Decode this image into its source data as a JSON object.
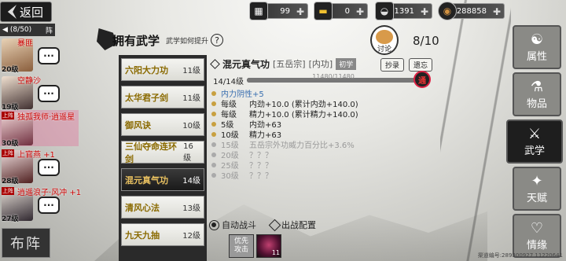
{
  "topbar": {
    "back_label": "返回",
    "resources": [
      {
        "icon": "ticket-icon",
        "value": "99"
      },
      {
        "icon": "gold-bar-icon",
        "value": "0"
      },
      {
        "icon": "silver-ingot-icon",
        "value": "1391"
      },
      {
        "icon": "copper-coin-icon",
        "value": "288858"
      }
    ]
  },
  "team": {
    "header": "(8/50)",
    "header_badge": "阵",
    "members": [
      {
        "name": "暴匪",
        "level": "20级",
        "tag": ""
      },
      {
        "name": "空静沙",
        "level": "19级",
        "tag": ""
      },
      {
        "name": "独孤我师·逍遥星",
        "level": "30级",
        "tag": "上阵"
      },
      {
        "name": "上官燕 +1",
        "level": "28级",
        "tag": "上阵"
      },
      {
        "name": "逍遥浪子·风冲 +1",
        "level": "27级",
        "tag": "上阵"
      }
    ],
    "formation_label": "布阵"
  },
  "nav": [
    {
      "label": "属性",
      "icon": "attribute-icon",
      "active": false
    },
    {
      "label": "物品",
      "icon": "item-icon",
      "active": false
    },
    {
      "label": "武学",
      "icon": "martial-arts-icon",
      "active": true
    },
    {
      "label": "天赋",
      "icon": "talent-icon",
      "active": false
    },
    {
      "label": "情缘",
      "icon": "affinity-icon",
      "active": false
    }
  ],
  "panel": {
    "title": "拥有武学",
    "hint": "武学如何提升",
    "help": "?",
    "discuss_label": "讨论",
    "count": "8/10"
  },
  "skills": [
    {
      "name": "六阳大力功",
      "level": "11级"
    },
    {
      "name": "太华君子剑",
      "level": "11级"
    },
    {
      "name": "御风诀",
      "level": "10级"
    },
    {
      "name": "三仙夺命连环剑",
      "level": "16级"
    },
    {
      "name": "混元真气功",
      "level": "14级"
    },
    {
      "name": "清风心法",
      "level": "13级"
    },
    {
      "name": "九天九抽",
      "level": "12级"
    }
  ],
  "detail": {
    "name": "混元真气功",
    "sect": "[五岳宗]",
    "type": "[内功]",
    "grade": "初学",
    "copy_button": "抄录",
    "forget_button": "遗忘",
    "level_text": "14/14级",
    "bar_text": "11480/11480",
    "progress": 1.0,
    "jing_badge": "通",
    "attributes": [
      {
        "a": "内力阴性+5",
        "b": "",
        "style": "blue"
      },
      {
        "a": "每级",
        "b": "内劲+10.0 (累计内劲+140.0)",
        "style": ""
      },
      {
        "a": "每级",
        "b": "精力+10.0 (累计精力+140.0)",
        "style": ""
      },
      {
        "a": "5级",
        "b": "内劲+63",
        "style": ""
      },
      {
        "a": "10级",
        "b": "精力+63",
        "style": ""
      },
      {
        "a": "15级",
        "b": "五岳宗外功威力百分比+3.6%",
        "style": "grey"
      },
      {
        "a": "20级",
        "b": "？？？",
        "style": "grey"
      },
      {
        "a": "25级",
        "b": "？？？",
        "style": "grey"
      },
      {
        "a": "30级",
        "b": "？？？",
        "style": "grey"
      }
    ],
    "auto_battle": "自动战斗",
    "battle_config": "出战配置",
    "priority_attack": "优先\n攻击",
    "slot_level": "11"
  },
  "footer": "渠道编号:289300927 11220641"
}
